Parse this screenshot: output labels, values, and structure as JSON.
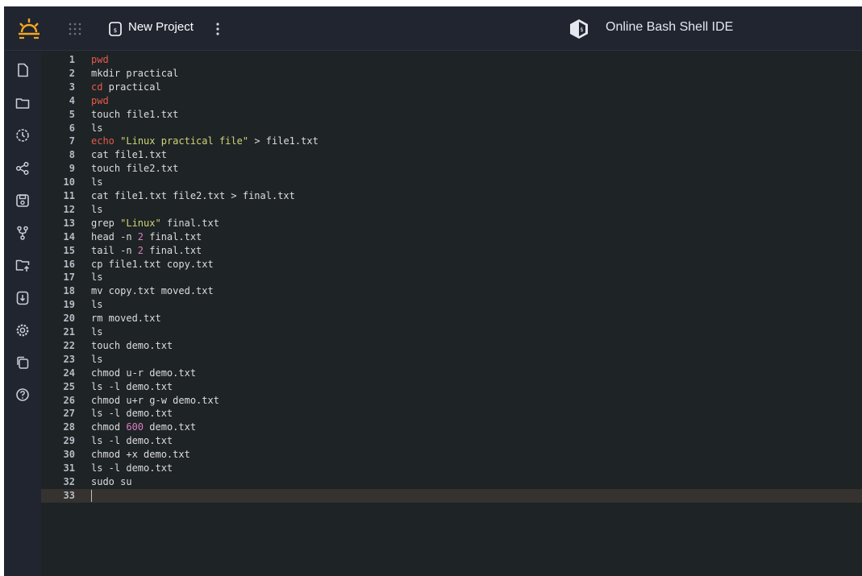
{
  "header": {
    "project_title": "New Project",
    "ide_title": "Online Bash Shell IDE"
  },
  "sidebar": {
    "items": [
      {
        "icon": "new-file-icon"
      },
      {
        "icon": "folder-icon"
      },
      {
        "icon": "history-icon"
      },
      {
        "icon": "share-icon"
      },
      {
        "icon": "save-icon"
      },
      {
        "icon": "git-branch-icon"
      },
      {
        "icon": "upload-folder-icon"
      },
      {
        "icon": "download-file-icon"
      },
      {
        "icon": "settings-icon"
      },
      {
        "icon": "copy-icon"
      },
      {
        "icon": "help-icon"
      }
    ]
  },
  "colors": {
    "accent": "#f5a623",
    "keyword": "#e35b4a",
    "string": "#cfd475",
    "number": "#d77fbe",
    "text": "#dcdcdc",
    "background": "#1e2326",
    "topbar": "#20252f"
  },
  "editor": {
    "active_line": 33,
    "lines": [
      {
        "num": "1",
        "tokens": [
          {
            "t": "pwd",
            "c": "kw"
          }
        ]
      },
      {
        "num": "2",
        "tokens": [
          {
            "t": "mkdir practical",
            "c": ""
          }
        ]
      },
      {
        "num": "3",
        "tokens": [
          {
            "t": "cd",
            "c": "kw"
          },
          {
            "t": " practical",
            "c": ""
          }
        ]
      },
      {
        "num": "4",
        "tokens": [
          {
            "t": "pwd",
            "c": "kw"
          }
        ]
      },
      {
        "num": "5",
        "tokens": [
          {
            "t": "touch file1.txt",
            "c": ""
          }
        ]
      },
      {
        "num": "6",
        "tokens": [
          {
            "t": "ls",
            "c": ""
          }
        ]
      },
      {
        "num": "7",
        "tokens": [
          {
            "t": "echo",
            "c": "kw"
          },
          {
            "t": " ",
            "c": ""
          },
          {
            "t": "\"Linux practical file\"",
            "c": "str"
          },
          {
            "t": " > file1.txt",
            "c": ""
          }
        ]
      },
      {
        "num": "8",
        "tokens": [
          {
            "t": "cat file1.txt",
            "c": ""
          }
        ]
      },
      {
        "num": "9",
        "tokens": [
          {
            "t": "touch file2.txt",
            "c": ""
          }
        ]
      },
      {
        "num": "10",
        "tokens": [
          {
            "t": "ls",
            "c": ""
          }
        ]
      },
      {
        "num": "11",
        "tokens": [
          {
            "t": "cat file1.txt file2.txt > final.txt",
            "c": ""
          }
        ]
      },
      {
        "num": "12",
        "tokens": [
          {
            "t": "ls",
            "c": ""
          }
        ]
      },
      {
        "num": "13",
        "tokens": [
          {
            "t": "grep ",
            "c": ""
          },
          {
            "t": "\"Linux\"",
            "c": "str"
          },
          {
            "t": " final.txt",
            "c": ""
          }
        ]
      },
      {
        "num": "14",
        "tokens": [
          {
            "t": "head -n ",
            "c": ""
          },
          {
            "t": "2",
            "c": "num"
          },
          {
            "t": " final.txt",
            "c": ""
          }
        ]
      },
      {
        "num": "15",
        "tokens": [
          {
            "t": "tail -n ",
            "c": ""
          },
          {
            "t": "2",
            "c": "num"
          },
          {
            "t": " final.txt",
            "c": ""
          }
        ]
      },
      {
        "num": "16",
        "tokens": [
          {
            "t": "cp file1.txt copy.txt",
            "c": ""
          }
        ]
      },
      {
        "num": "17",
        "tokens": [
          {
            "t": "ls",
            "c": ""
          }
        ]
      },
      {
        "num": "18",
        "tokens": [
          {
            "t": "mv copy.txt moved.txt",
            "c": ""
          }
        ]
      },
      {
        "num": "19",
        "tokens": [
          {
            "t": "ls",
            "c": ""
          }
        ]
      },
      {
        "num": "20",
        "tokens": [
          {
            "t": "rm moved.txt",
            "c": ""
          }
        ]
      },
      {
        "num": "21",
        "tokens": [
          {
            "t": "ls",
            "c": ""
          }
        ]
      },
      {
        "num": "22",
        "tokens": [
          {
            "t": "touch demo.txt",
            "c": ""
          }
        ]
      },
      {
        "num": "23",
        "tokens": [
          {
            "t": "ls",
            "c": ""
          }
        ]
      },
      {
        "num": "24",
        "tokens": [
          {
            "t": "chmod u-r demo.txt",
            "c": ""
          }
        ]
      },
      {
        "num": "25",
        "tokens": [
          {
            "t": "ls -l demo.txt",
            "c": ""
          }
        ]
      },
      {
        "num": "26",
        "tokens": [
          {
            "t": "chmod u+r g-w demo.txt",
            "c": ""
          }
        ]
      },
      {
        "num": "27",
        "tokens": [
          {
            "t": "ls -l demo.txt",
            "c": ""
          }
        ]
      },
      {
        "num": "28",
        "tokens": [
          {
            "t": "chmod ",
            "c": ""
          },
          {
            "t": "600",
            "c": "num"
          },
          {
            "t": " demo.txt",
            "c": ""
          }
        ]
      },
      {
        "num": "29",
        "tokens": [
          {
            "t": "ls -l demo.txt",
            "c": ""
          }
        ]
      },
      {
        "num": "30",
        "tokens": [
          {
            "t": "chmod +x demo.txt",
            "c": ""
          }
        ]
      },
      {
        "num": "31",
        "tokens": [
          {
            "t": "ls -l demo.txt",
            "c": ""
          }
        ]
      },
      {
        "num": "32",
        "tokens": [
          {
            "t": "sudo su",
            "c": ""
          }
        ]
      },
      {
        "num": "33",
        "tokens": []
      }
    ]
  }
}
